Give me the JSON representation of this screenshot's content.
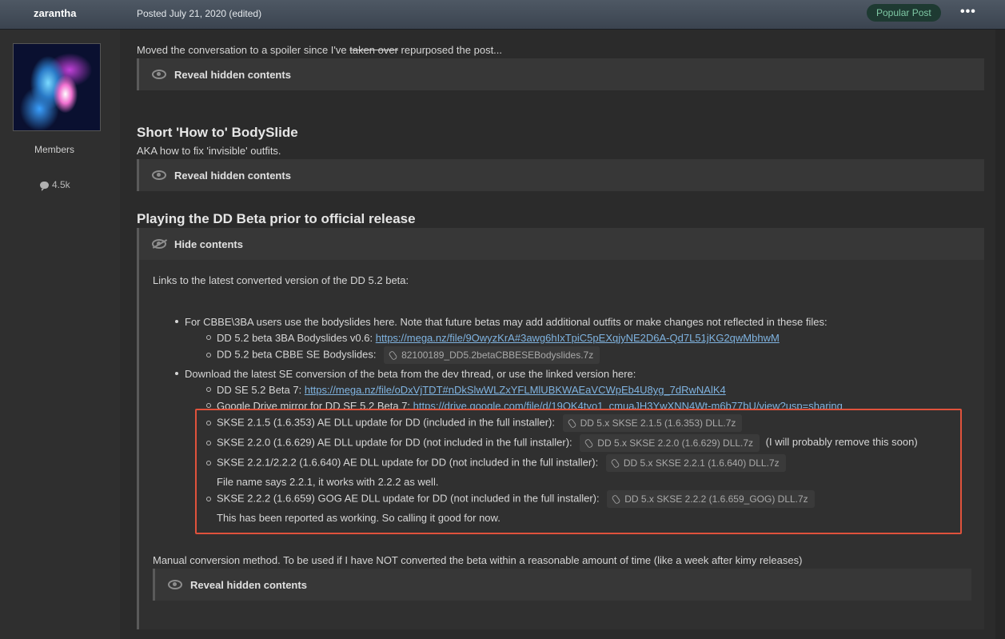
{
  "post": {
    "author": "zarantha",
    "posted": "Posted July 21, 2020 (edited)",
    "badge": "Popular Post",
    "more": "•••"
  },
  "user": {
    "group": "Members",
    "posts": "4.5k"
  },
  "intro": {
    "pre": "Moved the conversation to a spoiler since I've ",
    "struck": "taken over",
    "post": " repurposed the post..."
  },
  "spoiler": {
    "reveal": "Reveal hidden contents",
    "hide": "Hide contents"
  },
  "section1": {
    "title": "Short 'How to' BodySlide",
    "sub": "AKA how to fix 'invisible' outfits."
  },
  "section2": {
    "title": "Playing the DD Beta prior to official release",
    "links_intro": "Links to the latest converted version of the DD 5.2 beta:",
    "b1": "For CBBE\\3BA users use the bodyslides here. Note that future betas may add additional outfits or make changes not reflected in these files:",
    "b1a_label": "DD 5.2 beta 3BA Bodyslides v0.6: ",
    "b1a_link": "https://mega.nz/file/9OwyzKrA#3awg6hIxTpiC5pEXqjyNE2D6A-Qd7L51jKG2qwMbhwM",
    "b1b_label": "DD 5.2 beta CBBE SE Bodyslides:",
    "b1b_file": "82100189_DD5.2betaCBBESEBodyslides.7z",
    "b2": "Download the latest SE conversion of the beta from the dev thread, or use the linked version here:",
    "b2a_label": "DD SE 5.2 Beta 7: ",
    "b2a_link": "https://mega.nz/file/oDxVjTDT#nDkSlwWLZxYFLMlUBKWAEaVCWpEb4U8yg_7dRwNAlK4",
    "b2b_label": "Google Drive mirror for DD SE 5.2 Beta 7: ",
    "b2b_link": "https://drive.google.com/file/d/19OK4tvo1_cmuaJH3YwXNN4Wt-m6b77bU/view?usp=sharing",
    "s1_label": "SKSE 2.1.5 (1.6.353) AE DLL update for DD (included in the full installer):",
    "s1_file": "DD 5.x SKSE 2.1.5 (1.6.353) DLL.7z",
    "s2_label": "SKSE 2.2.0 (1.6.629) AE DLL update for DD (not included in the full installer):",
    "s2_file": "DD 5.x SKSE 2.2.0 (1.6.629) DLL.7z",
    "s2_note": "(I will probably remove this soon)",
    "s3_label": "SKSE 2.2.1/2.2.2 (1.6.640) AE DLL update for DD (not included in the full installer):",
    "s3_file": "DD 5.x SKSE 2.2.1 (1.6.640) DLL.7z",
    "s3_note": "File name says 2.2.1, it works with 2.2.2 as well.",
    "s4_label": "SKSE 2.2.2 (1.6.659) GOG AE DLL update for DD (not included in the full installer):",
    "s4_file": "DD 5.x SKSE 2.2.2 (1.6.659_GOG) DLL.7z",
    "s4_note": "This has been reported as working. So calling it good for now.",
    "manual": "Manual conversion method. To be used if I have NOT converted the beta within a reasonable amount of time (like a week after kimy releases)"
  }
}
